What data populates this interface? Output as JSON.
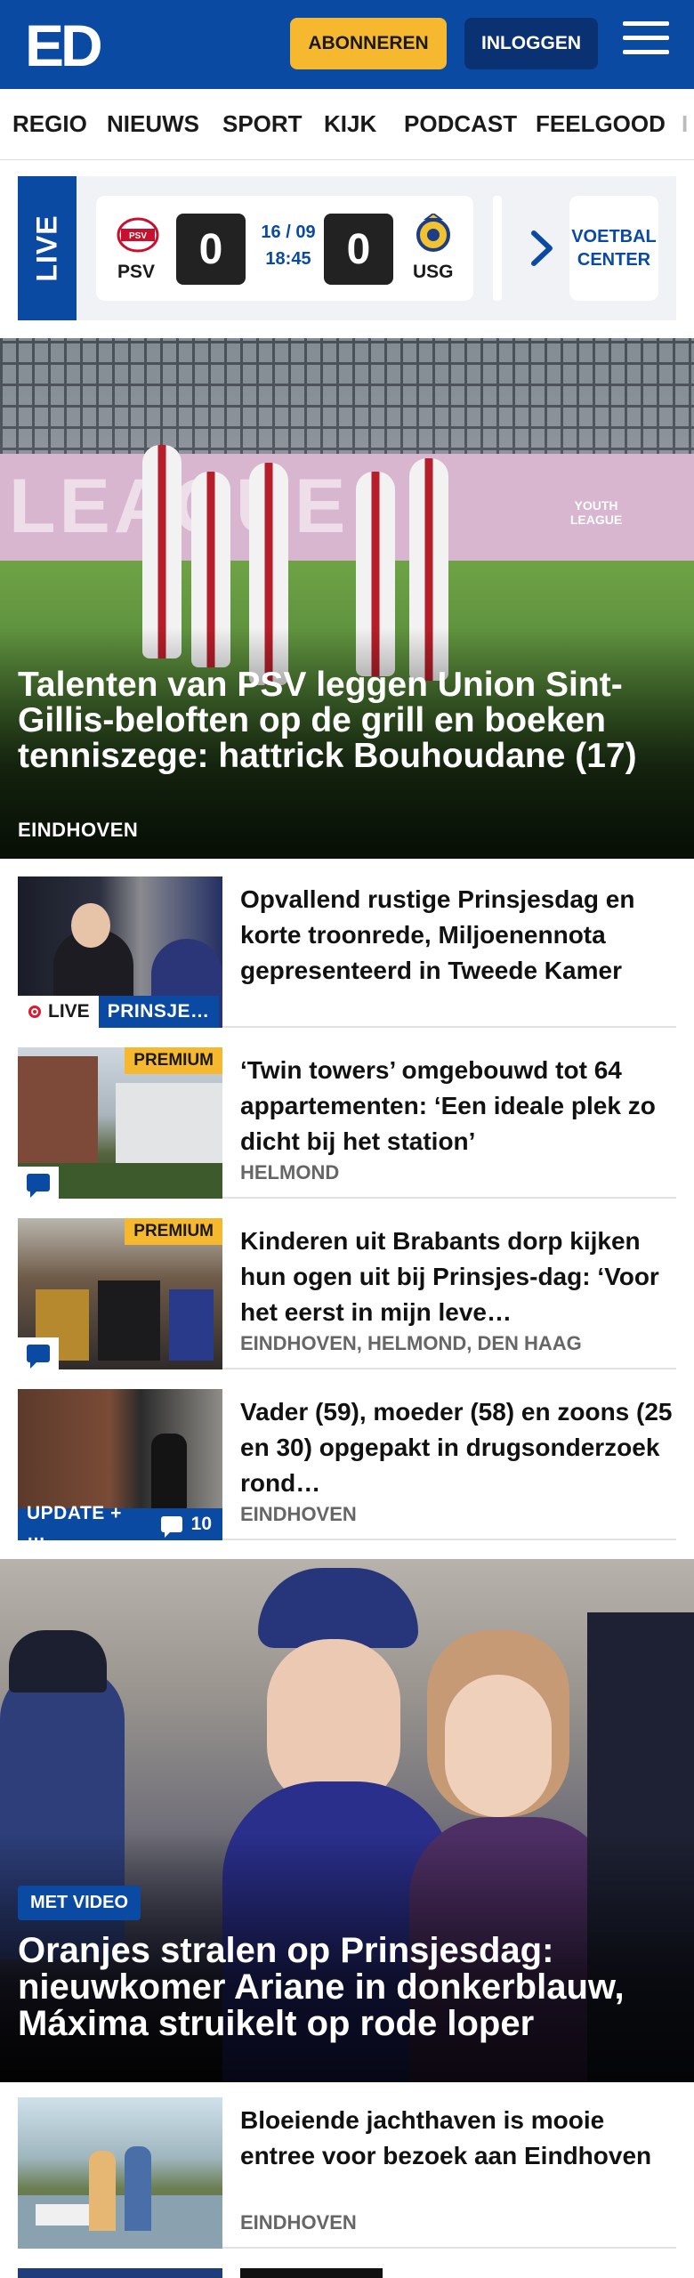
{
  "header": {
    "logo": "ED",
    "subscribe_label": "ABONNEREN",
    "login_label": "INLOGGEN",
    "brand_color": "#0b4aa2",
    "accent_color": "#f5b82e"
  },
  "nav": {
    "items": [
      "REGIO",
      "NIEUWS",
      "SPORT",
      "KIJK",
      "PODCAST",
      "FEELGOOD"
    ]
  },
  "live_scores": {
    "tab_label": "LIVE",
    "match": {
      "home_team": "PSV",
      "away_team": "USG",
      "home_score": "0",
      "away_score": "0",
      "date": "16 / 09",
      "time": "18:45"
    },
    "football_center_label": "VOETBAL CENTER"
  },
  "hero": {
    "title": "Talenten van PSV leggen Union Sint-Gillis-beloften op de grill en boeken tenniszege: hattrick Bouhoudane (17)",
    "location": "EINDHOVEN",
    "image_banner_text": "LEAGUE",
    "image_badge_text": "YOUTH LEAGUE"
  },
  "articles": [
    {
      "title": "Opvallend rustige Prinsjesdag en korte troonrede, Miljoenennota gepresenteerd in Tweede Kamer",
      "live_label": "LIVE",
      "tag": "PRINSJE…"
    },
    {
      "title": "‘Twin towers’ omgebouwd tot 64 appartementen: ‘Een ideale plek zo dicht bij het station’",
      "location": "HELMOND",
      "premium": "PREMIUM"
    },
    {
      "title": "Kinderen uit Brabants dorp kijken hun ogen uit bij Prinsjes-dag: ‘Voor het eerst in mijn leve…",
      "location": "EINDHOVEN, HELMOND, DEN HAAG",
      "premium": "PREMIUM"
    },
    {
      "title": "Vader (59), moeder (58) en zoons (25 en 30) opgepakt in drugsonderzoek rond…",
      "location": "EINDHOVEN",
      "update_tag": "UPDATE + …",
      "comment_count": "10"
    }
  ],
  "hero2": {
    "badge": "MET VIDEO",
    "title": "Oranjes stralen op Prinsjesdag: nieuwkomer Ariane in donkerblauw, Máxima struikelt op rode loper"
  },
  "articles2": [
    {
      "title": "Bloeiende jachthaven is mooie entree voor bezoek aan Eindhoven",
      "location": "EINDHOVEN"
    }
  ]
}
